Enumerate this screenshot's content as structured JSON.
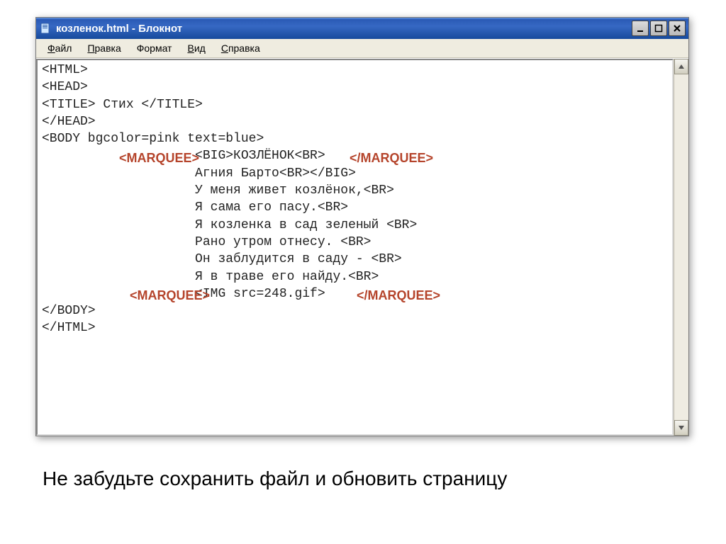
{
  "titlebar": {
    "title": "козленок.html - Блокнот"
  },
  "menu": {
    "file": {
      "u": "Ф",
      "rest": "айл"
    },
    "edit": {
      "u": "П",
      "rest": "равка"
    },
    "format": {
      "label": "Формат"
    },
    "view": {
      "u": "В",
      "rest": "ид"
    },
    "help": {
      "u": "С",
      "rest": "правка"
    }
  },
  "code": {
    "l1": "<HTML>",
    "l2": "<HEAD>",
    "l3": "<TITLE> Стих </TITLE>",
    "l4": "</HEAD>",
    "l5": "<BODY bgcolor=pink text=blue>",
    "l6": "                    <BIG>КОЗЛЁНОК<BR>",
    "l7": "                    Агния Барто<BR></BIG>",
    "l8": "                    У меня живет козлёнок,<BR>",
    "l9": "                    Я сама его пасу.<BR>",
    "l10": "                    Я козленка в сад зеленый <BR>",
    "l11": "                    Рано утром отнесу. <BR>",
    "l12": "                    Он заблудится в саду - <BR>",
    "l13": "                    Я в траве его найду.<BR>",
    "l14": "                    <IMG src=248.gif>",
    "l15": "</BODY>",
    "l16": "</HTML>"
  },
  "overlay": {
    "marquee_open": "<MARQUEE>",
    "marquee_close": "</MARQUEE>"
  },
  "caption": "Не забудьте сохранить файл и обновить страницу"
}
